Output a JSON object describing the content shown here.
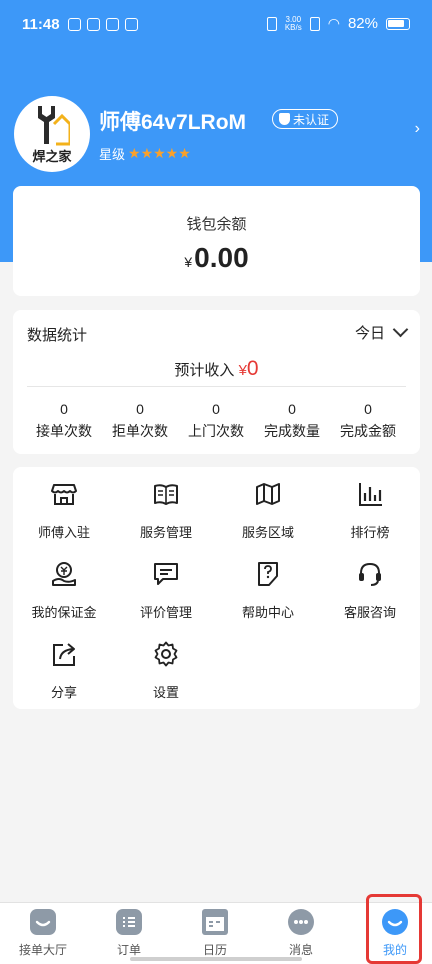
{
  "status_bar": {
    "time": "11:48",
    "speed_value": "3.00",
    "speed_unit": "KB/s",
    "battery": "82%"
  },
  "profile": {
    "avatar_brand": "焊之家",
    "username": "师傅64v7LRoM",
    "verify_badge": "未认证",
    "rating_label": "星级",
    "rating_stars": "★★★★★",
    "rating_value": 5
  },
  "wallet": {
    "label": "钱包余额",
    "currency": "¥",
    "balance": "0.00"
  },
  "stats": {
    "title": "数据统计",
    "period": "今日",
    "income_label": "预计收入",
    "income_currency": "¥",
    "income_value": "0",
    "items": [
      {
        "value": "0",
        "label": "接单次数"
      },
      {
        "value": "0",
        "label": "拒单次数"
      },
      {
        "value": "0",
        "label": "上门次数"
      },
      {
        "value": "0",
        "label": "完成数量"
      },
      {
        "value": "0",
        "label": "完成金额"
      }
    ]
  },
  "menu": {
    "items": [
      {
        "label": "师傅入驻",
        "icon": "storefront-icon"
      },
      {
        "label": "服务管理",
        "icon": "book-icon"
      },
      {
        "label": "服务区域",
        "icon": "map-icon"
      },
      {
        "label": "排行榜",
        "icon": "bar-chart-icon"
      },
      {
        "label": "我的保证金",
        "icon": "deposit-icon"
      },
      {
        "label": "评价管理",
        "icon": "comment-icon"
      },
      {
        "label": "帮助中心",
        "icon": "help-icon"
      },
      {
        "label": "客服咨询",
        "icon": "headset-icon"
      },
      {
        "label": "分享",
        "icon": "share-icon"
      },
      {
        "label": "设置",
        "icon": "settings-icon"
      }
    ]
  },
  "bottom_nav": {
    "items": [
      {
        "label": "接单大厅",
        "icon": "hall-icon"
      },
      {
        "label": "订单",
        "icon": "order-icon"
      },
      {
        "label": "日历",
        "icon": "calendar-icon"
      },
      {
        "label": "消息",
        "icon": "message-icon"
      },
      {
        "label": "我的",
        "icon": "profile-icon"
      }
    ],
    "active": "我的"
  },
  "colors": {
    "brand_blue": "#3d98f8",
    "star_orange": "#f9a12c",
    "income_red": "#e53935",
    "highlight_red": "#e53935"
  }
}
